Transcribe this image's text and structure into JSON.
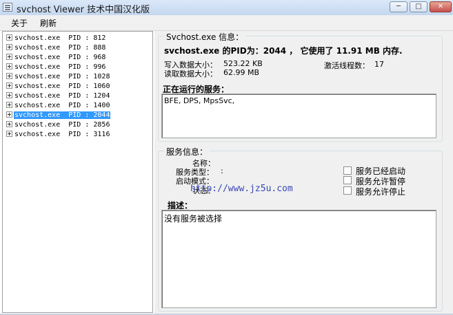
{
  "window": {
    "title": "svchost Viewer 技术中国汉化版",
    "min_label": "─",
    "max_label": "□",
    "close_label": "✕"
  },
  "menu": {
    "about": "关于",
    "refresh": "刷新"
  },
  "tree": [
    {
      "text": "svchost.exe  PID : 812",
      "selected": false
    },
    {
      "text": "svchost.exe  PID : 888",
      "selected": false
    },
    {
      "text": "svchost.exe  PID : 968",
      "selected": false
    },
    {
      "text": "svchost.exe  PID : 996",
      "selected": false
    },
    {
      "text": "svchost.exe  PID : 1028",
      "selected": false
    },
    {
      "text": "svchost.exe  PID : 1060",
      "selected": false
    },
    {
      "text": "svchost.exe  PID : 1204",
      "selected": false
    },
    {
      "text": "svchost.exe  PID : 1400",
      "selected": false
    },
    {
      "text": "svchost.exe  PID : 2044",
      "selected": true
    },
    {
      "text": "svchost.exe  PID : 2856",
      "selected": false
    },
    {
      "text": "svchost.exe  PID : 3116",
      "selected": false
    }
  ],
  "info": {
    "group_label": "Svchost.exe 信息：",
    "summary": "svchost.exe 的PID为：2044 ， 它使用了 11.91 MB 内存.",
    "write_label": "写入数据大小：",
    "write_value": "523.22 KB",
    "read_label": "读取数据大小：",
    "read_value": "62.99 MB",
    "threads_label": "激活线程数：",
    "threads_value": "17",
    "running_label": "正在运行的服务：",
    "running_services": "BFE, DPS, MpsSvc,"
  },
  "service": {
    "group_label": "服务信息：",
    "name_label": "名称：",
    "type_label": "服务类型：",
    "type_value": ":",
    "start_label": "启动模式：",
    "status_label": "状态：",
    "chk_started": "服务已经启动",
    "chk_pause": "服务允许暂停",
    "chk_stop": "服务允许停止",
    "desc_label": "描述：",
    "desc_text": "没有服务被选择"
  },
  "watermark": "http://www.jz5u.com"
}
